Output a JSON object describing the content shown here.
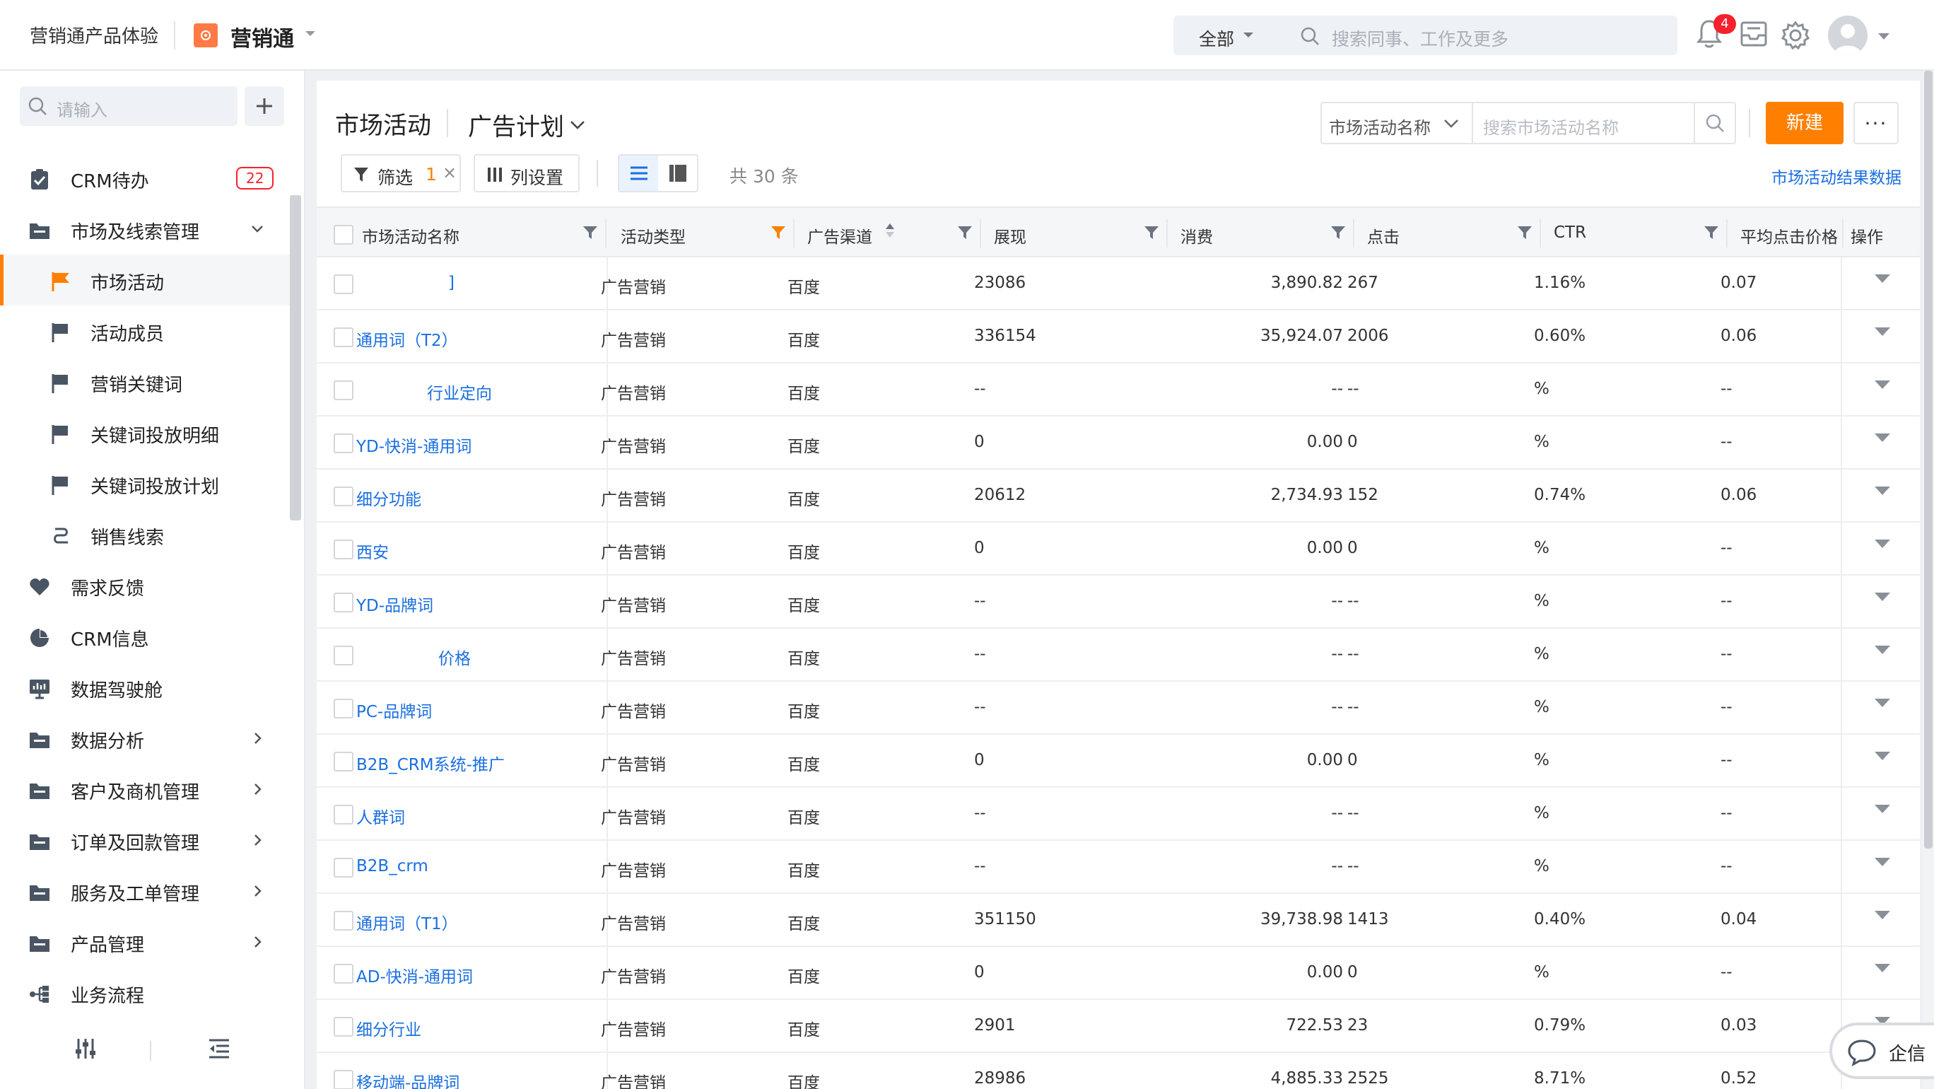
{
  "topbar": {
    "app_title": "营销通产品体验",
    "brand": "营销通",
    "search_scope": "全部",
    "search_placeholder": "搜索同事、工作及更多",
    "notification_count": "4"
  },
  "sidebar": {
    "search_placeholder": "请输入",
    "items": [
      {
        "label": "CRM待办",
        "count": "22",
        "icon": "clipboard-check-icon"
      },
      {
        "label": "市场及线索管理",
        "icon": "folder-icon",
        "expanded": true
      },
      {
        "label": "市场活动",
        "icon": "flag-icon",
        "active": true
      },
      {
        "label": "活动成员",
        "icon": "flag-icon"
      },
      {
        "label": "营销关键词",
        "icon": "flag-icon"
      },
      {
        "label": "关键词投放明细",
        "icon": "flag-icon"
      },
      {
        "label": "关键词投放计划",
        "icon": "flag-icon"
      },
      {
        "label": "销售线索",
        "icon": "lead-icon"
      },
      {
        "label": "需求反馈",
        "icon": "heart-icon"
      },
      {
        "label": "CRM信息",
        "icon": "pie-chart-icon"
      },
      {
        "label": "数据驾驶舱",
        "icon": "dashboard-icon"
      },
      {
        "label": "数据分析",
        "icon": "folder-icon"
      },
      {
        "label": "客户及商机管理",
        "icon": "folder-icon"
      },
      {
        "label": "订单及回款管理",
        "icon": "folder-icon"
      },
      {
        "label": "服务及工单管理",
        "icon": "folder-icon"
      },
      {
        "label": "产品管理",
        "icon": "folder-icon"
      },
      {
        "label": "业务流程",
        "icon": "workflow-icon"
      }
    ]
  },
  "main": {
    "title": "市场活动",
    "view": "广告计划",
    "search_field": "市场活动名称",
    "search_placeholder": "搜索市场活动名称",
    "new_button": "新建",
    "more_button": "···",
    "filter_label": "筛选",
    "filter_count": "1",
    "filter_clear": "×",
    "columns_label": "列设置",
    "total": "共 30 条",
    "result_link": "市场活动结果数据"
  },
  "table": {
    "headers": [
      "市场活动名称",
      "活动类型",
      "广告渠道",
      "展现",
      "消费",
      "点击",
      "CTR",
      "平均点击价格",
      "操作"
    ],
    "rows": [
      [
        "]",
        "广告营销",
        "百度",
        "23086",
        "3,890.82",
        "267",
        "1.16%",
        "0.07"
      ],
      [
        "通用词（T2）",
        "广告营销",
        "百度",
        "336154",
        "35,924.07",
        "2006",
        "0.60%",
        "0.06"
      ],
      [
        "行业定向",
        "广告营销",
        "百度",
        "--",
        "--",
        "--",
        "%",
        "--"
      ],
      [
        "YD-快消-通用词",
        "广告营销",
        "百度",
        "0",
        "0.00",
        "0",
        "%",
        "--"
      ],
      [
        "细分功能",
        "广告营销",
        "百度",
        "20612",
        "2,734.93",
        "152",
        "0.74%",
        "0.06"
      ],
      [
        "西安",
        "广告营销",
        "百度",
        "0",
        "0.00",
        "0",
        "%",
        "--"
      ],
      [
        "YD-品牌词",
        "广告营销",
        "百度",
        "--",
        "--",
        "--",
        "%",
        "--"
      ],
      [
        "价格",
        "广告营销",
        "百度",
        "--",
        "--",
        "--",
        "%",
        "--"
      ],
      [
        "PC-品牌词",
        "广告营销",
        "百度",
        "--",
        "--",
        "--",
        "%",
        "--"
      ],
      [
        "B2B_CRM系统-推广",
        "广告营销",
        "百度",
        "0",
        "0.00",
        "0",
        "%",
        "--"
      ],
      [
        "人群词",
        "广告营销",
        "百度",
        "--",
        "--",
        "--",
        "%",
        "--"
      ],
      [
        "B2B_crm",
        "广告营销",
        "百度",
        "--",
        "--",
        "--",
        "%",
        "--"
      ],
      [
        "通用词（T1）",
        "广告营销",
        "百度",
        "351150",
        "39,738.98",
        "1413",
        "0.40%",
        "0.04"
      ],
      [
        "AD-快消-通用词",
        "广告营销",
        "百度",
        "0",
        "0.00",
        "0",
        "%",
        "--"
      ],
      [
        "细分行业",
        "广告营销",
        "百度",
        "2901",
        "722.53",
        "23",
        "0.79%",
        "0.03"
      ],
      [
        "移动端-品牌词",
        "广告营销",
        "百度",
        "28986",
        "4,885.33",
        "2525",
        "8.71%",
        "0.52"
      ]
    ]
  },
  "chat": {
    "label": "企信"
  },
  "colors": {
    "accent": "#ff8000",
    "link": "#1a6fe0",
    "badge": "#f5222d"
  }
}
